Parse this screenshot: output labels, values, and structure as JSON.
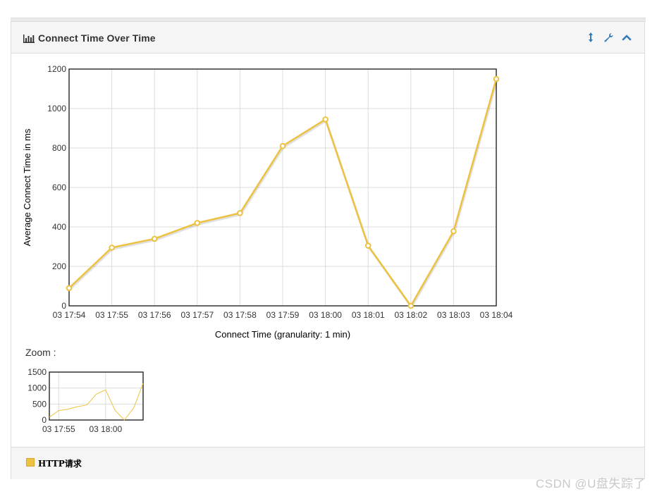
{
  "panel": {
    "title": "Connect Time Over Time",
    "icons": [
      "bar-chart-icon",
      "resize-vertical-icon",
      "wrench-icon",
      "chevron-up-icon"
    ]
  },
  "zoom": {
    "label": "Zoom :"
  },
  "legend": {
    "label": "HTTP请求",
    "color": "#edc240"
  },
  "watermark": "CSDN @U盘失踪了",
  "colors": {
    "accent": "#337ab7",
    "series": "#edc240"
  },
  "chart_data": [
    {
      "type": "line",
      "title": "",
      "xlabel": "Connect Time (granularity: 1 min)",
      "ylabel": "Average Connect Time in ms",
      "x": [
        "03 17:54",
        "03 17:55",
        "03 17:56",
        "03 17:57",
        "03 17:58",
        "03 17:59",
        "03 18:00",
        "03 18:01",
        "03 18:02",
        "03 18:03",
        "03 18:04"
      ],
      "y_ticks": [
        "0",
        "200",
        "400",
        "600",
        "800",
        "1000",
        "1200"
      ],
      "ylim": [
        0,
        1200
      ],
      "grid": true,
      "series": [
        {
          "name": "HTTP请求",
          "values": [
            90,
            295,
            340,
            420,
            470,
            810,
            945,
            305,
            0,
            378,
            1150
          ]
        }
      ]
    },
    {
      "type": "line",
      "title": "Zoom :",
      "x_ticks": [
        "03 17:55",
        "03 18:00"
      ],
      "y_ticks": [
        "0",
        "500",
        "1000",
        "1500"
      ],
      "ylim": [
        0,
        1500
      ],
      "grid": true,
      "series": [
        {
          "name": "HTTP请求",
          "values": [
            90,
            295,
            340,
            420,
            470,
            810,
            945,
            305,
            0,
            378,
            1150
          ]
        }
      ]
    }
  ]
}
